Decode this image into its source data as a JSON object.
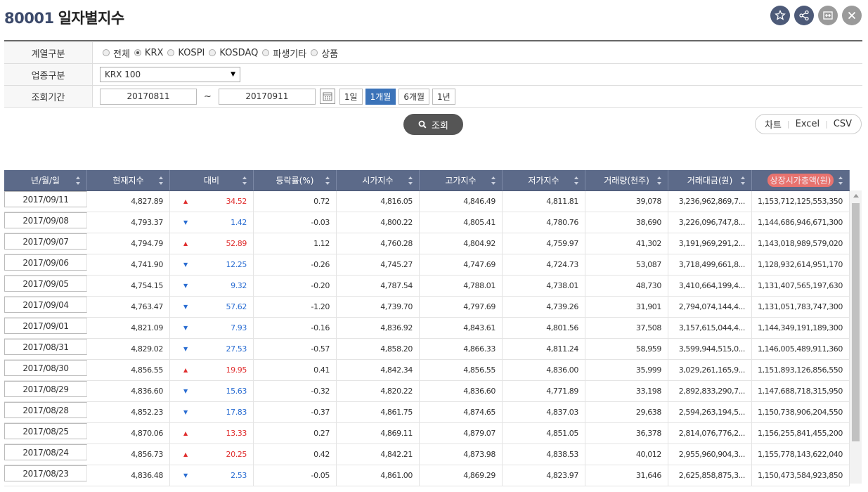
{
  "header": {
    "code": "80001",
    "name": "일자별지수",
    "icons": [
      "star-icon",
      "share-icon",
      "expand-icon",
      "close-icon"
    ]
  },
  "filters": {
    "series": {
      "label": "계열구분",
      "options": [
        "전체",
        "KRX",
        "KOSPI",
        "KOSDAQ",
        "파생기타",
        "상품"
      ],
      "selected": "KRX"
    },
    "industry": {
      "label": "업종구분",
      "value": "KRX 100"
    },
    "period": {
      "label": "조회기간",
      "start": "20170811",
      "tilde": "~",
      "end": "20170911",
      "buttons": [
        "1일",
        "1개월",
        "6개월",
        "1년"
      ],
      "active": "1개월"
    }
  },
  "actions": {
    "search_label": "조회",
    "chart_label": "차트",
    "excel_label": "Excel",
    "csv_label": "CSV"
  },
  "table": {
    "columns": [
      "년/월/일",
      "현재지수",
      "대비",
      "등락률(%)",
      "시가지수",
      "고가지수",
      "저가지수",
      "거래량(천주)",
      "거래대금(원)",
      "상장시가총액(원)"
    ],
    "rows": [
      {
        "date": "2017/09/11",
        "close": "4,827.89",
        "dir": "up",
        "chg": "34.52",
        "rate": "0.72",
        "open": "4,816.05",
        "high": "4,846.49",
        "low": "4,811.81",
        "vol": "39,078",
        "amt": "3,236,962,869,7...",
        "cap": "1,153,712,125,553,350"
      },
      {
        "date": "2017/09/08",
        "close": "4,793.37",
        "dir": "down",
        "chg": "1.42",
        "rate": "-0.03",
        "open": "4,800.22",
        "high": "4,805.41",
        "low": "4,780.76",
        "vol": "38,690",
        "amt": "3,226,096,747,8...",
        "cap": "1,144,686,946,671,300"
      },
      {
        "date": "2017/09/07",
        "close": "4,794.79",
        "dir": "up",
        "chg": "52.89",
        "rate": "1.12",
        "open": "4,760.28",
        "high": "4,804.92",
        "low": "4,759.97",
        "vol": "41,302",
        "amt": "3,191,969,291,2...",
        "cap": "1,143,018,989,579,020"
      },
      {
        "date": "2017/09/06",
        "close": "4,741.90",
        "dir": "down",
        "chg": "12.25",
        "rate": "-0.26",
        "open": "4,745.27",
        "high": "4,747.69",
        "low": "4,724.73",
        "vol": "53,087",
        "amt": "3,718,499,661,8...",
        "cap": "1,128,932,614,951,170"
      },
      {
        "date": "2017/09/05",
        "close": "4,754.15",
        "dir": "down",
        "chg": "9.32",
        "rate": "-0.20",
        "open": "4,787.54",
        "high": "4,788.01",
        "low": "4,738.01",
        "vol": "48,730",
        "amt": "3,410,664,199,4...",
        "cap": "1,131,407,565,197,630"
      },
      {
        "date": "2017/09/04",
        "close": "4,763.47",
        "dir": "down",
        "chg": "57.62",
        "rate": "-1.20",
        "open": "4,739.70",
        "high": "4,797.69",
        "low": "4,739.26",
        "vol": "31,901",
        "amt": "2,794,074,144,4...",
        "cap": "1,131,051,783,747,300"
      },
      {
        "date": "2017/09/01",
        "close": "4,821.09",
        "dir": "down",
        "chg": "7.93",
        "rate": "-0.16",
        "open": "4,836.92",
        "high": "4,843.61",
        "low": "4,801.56",
        "vol": "37,508",
        "amt": "3,157,615,044,4...",
        "cap": "1,144,349,191,189,300"
      },
      {
        "date": "2017/08/31",
        "close": "4,829.02",
        "dir": "down",
        "chg": "27.53",
        "rate": "-0.57",
        "open": "4,858.20",
        "high": "4,866.33",
        "low": "4,811.24",
        "vol": "58,959",
        "amt": "3,599,944,515,0...",
        "cap": "1,146,005,489,911,360"
      },
      {
        "date": "2017/08/30",
        "close": "4,856.55",
        "dir": "up",
        "chg": "19.95",
        "rate": "0.41",
        "open": "4,842.34",
        "high": "4,856.55",
        "low": "4,836.00",
        "vol": "35,999",
        "amt": "3,029,261,165,9...",
        "cap": "1,151,893,126,856,550"
      },
      {
        "date": "2017/08/29",
        "close": "4,836.60",
        "dir": "down",
        "chg": "15.63",
        "rate": "-0.32",
        "open": "4,820.22",
        "high": "4,836.60",
        "low": "4,771.89",
        "vol": "33,198",
        "amt": "2,892,833,290,7...",
        "cap": "1,147,688,718,315,950"
      },
      {
        "date": "2017/08/28",
        "close": "4,852.23",
        "dir": "down",
        "chg": "17.83",
        "rate": "-0.37",
        "open": "4,861.75",
        "high": "4,874.65",
        "low": "4,837.03",
        "vol": "29,638",
        "amt": "2,594,263,194,5...",
        "cap": "1,150,738,906,204,550"
      },
      {
        "date": "2017/08/25",
        "close": "4,870.06",
        "dir": "up",
        "chg": "13.33",
        "rate": "0.27",
        "open": "4,869.11",
        "high": "4,879.07",
        "low": "4,851.05",
        "vol": "36,378",
        "amt": "2,814,076,776,2...",
        "cap": "1,156,255,841,455,200"
      },
      {
        "date": "2017/08/24",
        "close": "4,856.73",
        "dir": "up",
        "chg": "20.25",
        "rate": "0.42",
        "open": "4,842.21",
        "high": "4,873.98",
        "low": "4,838.53",
        "vol": "40,012",
        "amt": "2,955,960,904,3...",
        "cap": "1,155,778,143,622,040"
      },
      {
        "date": "2017/08/23",
        "close": "4,836.48",
        "dir": "down",
        "chg": "2.53",
        "rate": "-0.05",
        "open": "4,861.00",
        "high": "4,869.29",
        "low": "4,823.97",
        "vol": "31,646",
        "amt": "2,625,858,875,3...",
        "cap": "1,150,473,584,923,850"
      }
    ]
  },
  "colors": {
    "up": "#e02f2f",
    "down": "#2a6dd2",
    "header_bg": "#5c6a89",
    "active_btn": "#3b73b9"
  }
}
